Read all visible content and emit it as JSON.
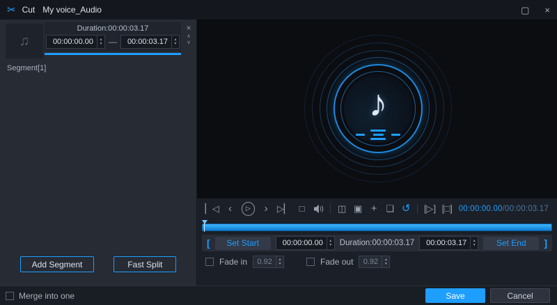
{
  "titlebar": {
    "scissors_icon": "✂",
    "title": "Cut",
    "subtitle": "My voice_Audio",
    "maximize_icon": "▢",
    "close_icon": "×"
  },
  "segment_panel": {
    "thumb_note_icon": "♫",
    "duration_label": "Duration:00:00:03.17",
    "start_value": "00:00:00.00",
    "range_dash": "—",
    "end_value": "00:00:03.17",
    "close_icon": "×",
    "up_icon": "∧",
    "down_icon": "∨",
    "segment_label": "Segment[1]",
    "add_segment_label": "Add Segment",
    "fast_split_label": "Fast Split"
  },
  "preview": {
    "note_icon": "♪"
  },
  "transport": {
    "skip_start_icon": "▏◁",
    "step_back_icon": "‹",
    "play_icon": "▷",
    "step_forward_icon": "›",
    "skip_end_icon": "▷▏",
    "stop_icon": "□",
    "ab_segments_icon": "◫",
    "frame_icon": "▣",
    "add_icon": "+",
    "copy_icon": "❏",
    "reset_icon": "↺",
    "clip_play_icon": "[▷]",
    "clip_stop_icon": "[□]",
    "time_current": "00:00:00.00",
    "time_total": "/00:00:03.17"
  },
  "trim": {
    "bracket_left": "[",
    "set_start_label": "Set Start",
    "start_value": "00:00:00.00",
    "duration_label": "Duration:00:00:03.17",
    "end_value": "00:00:03.17",
    "set_end_label": "Set End",
    "bracket_right": "]"
  },
  "fade": {
    "fade_in_label": "Fade in",
    "fade_in_value": "0.92",
    "fade_out_label": "Fade out",
    "fade_out_value": "0.92"
  },
  "footer": {
    "merge_label": "Merge into one",
    "save_label": "Save",
    "cancel_label": "Cancel"
  },
  "colors": {
    "accent": "#1e9eff"
  }
}
